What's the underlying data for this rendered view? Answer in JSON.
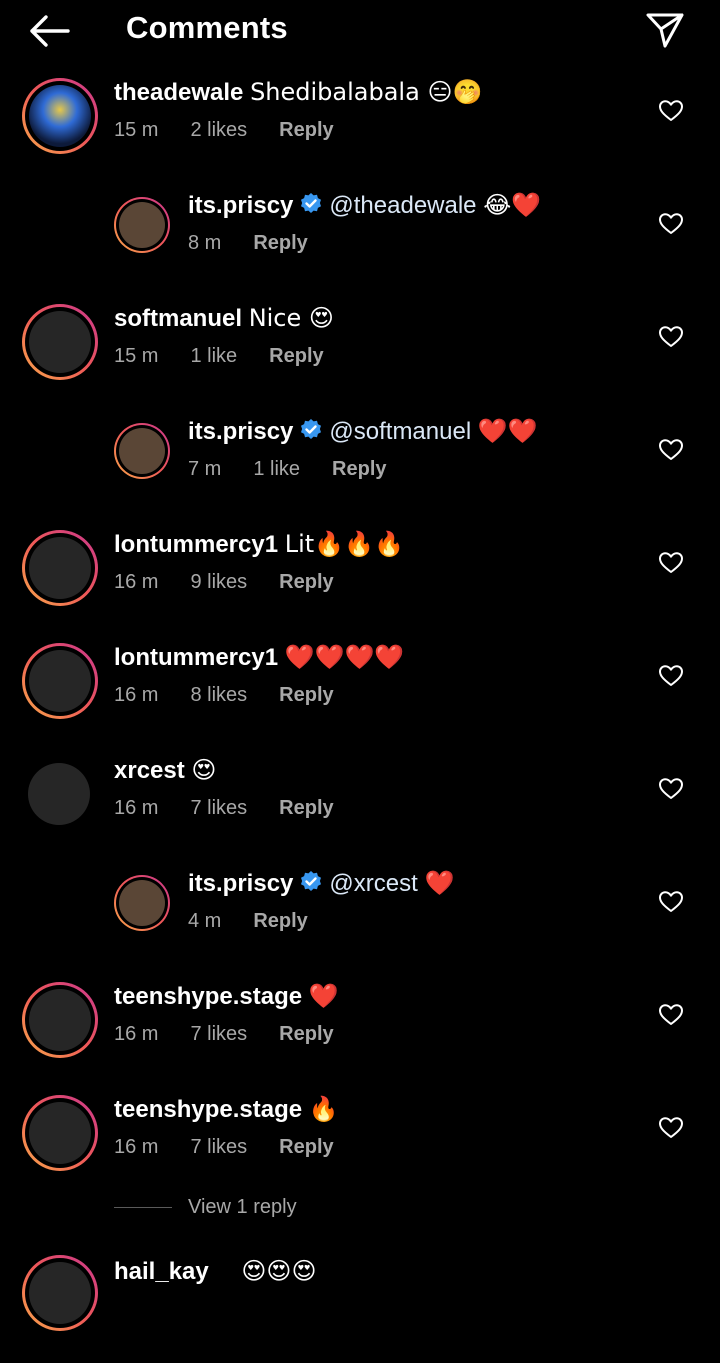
{
  "header": {
    "title": "Comments"
  },
  "comments": [
    {
      "username": "theadewale",
      "verified": false,
      "mention": "",
      "text": "Shedibalabala 😑🤭",
      "time": "15 m",
      "likes": "2 likes",
      "reply": "Reply",
      "avatar": "ring",
      "reply_indent": false
    },
    {
      "username": "its.priscy",
      "verified": true,
      "mention": "@theadewale",
      "text": "😂❤️",
      "time": "8 m",
      "likes": "",
      "reply": "Reply",
      "avatar": "ring",
      "reply_indent": true
    },
    {
      "username": "softmanuel",
      "verified": false,
      "mention": "",
      "text": "Nice 😍",
      "time": "15 m",
      "likes": "1 like",
      "reply": "Reply",
      "avatar": "ring",
      "reply_indent": false
    },
    {
      "username": "its.priscy",
      "verified": true,
      "mention": "@softmanuel",
      "text": "❤️❤️",
      "time": "7 m",
      "likes": "1 like",
      "reply": "Reply",
      "avatar": "ring",
      "reply_indent": true
    },
    {
      "username": "lontummercy1",
      "verified": false,
      "mention": "",
      "text": "Lit🔥🔥🔥",
      "time": "16 m",
      "likes": "9 likes",
      "reply": "Reply",
      "avatar": "ring",
      "reply_indent": false
    },
    {
      "username": "lontummercy1",
      "verified": false,
      "mention": "",
      "text": "❤️❤️❤️❤️",
      "time": "16 m",
      "likes": "8 likes",
      "reply": "Reply",
      "avatar": "ring",
      "reply_indent": false
    },
    {
      "username": "xrcest",
      "verified": false,
      "mention": "",
      "text": "😍",
      "time": "16 m",
      "likes": "7 likes",
      "reply": "Reply",
      "avatar": "plain",
      "reply_indent": false
    },
    {
      "username": "its.priscy",
      "verified": true,
      "mention": "@xrcest",
      "text": "❤️",
      "time": "4 m",
      "likes": "",
      "reply": "Reply",
      "avatar": "ring",
      "reply_indent": true
    },
    {
      "username": "teenshype.stage",
      "verified": false,
      "mention": "",
      "text": "❤️",
      "time": "16 m",
      "likes": "7 likes",
      "reply": "Reply",
      "avatar": "ring",
      "reply_indent": false
    },
    {
      "username": "teenshype.stage",
      "verified": false,
      "mention": "",
      "text": "🔥",
      "time": "16 m",
      "likes": "7 likes",
      "reply": "Reply",
      "avatar": "ring",
      "reply_indent": false
    }
  ],
  "view_replies": "View 1 reply",
  "partial_comment": {
    "username": "hail_kay",
    "text": "😍😍😍"
  },
  "colors": {
    "background": "#000000",
    "muted": "#a8a8a8",
    "verified": "#3897f0",
    "ring_start": "#f9a94a",
    "ring_end": "#c9368f"
  }
}
